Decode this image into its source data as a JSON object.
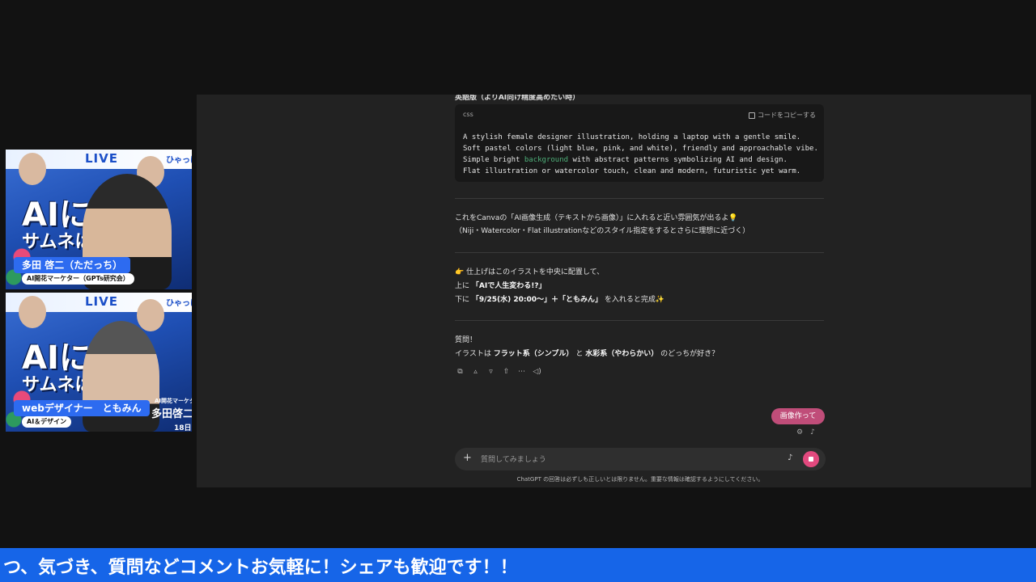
{
  "camera_top": {
    "live_label": "LIVE",
    "headline": "AIに指示",
    "subline": "サムネはとる？",
    "side_text": "ひゃっほ",
    "name": "多田 啓二（ただっち）",
    "role": "AI開花マーケター（GPTs研究会）"
  },
  "camera_bottom": {
    "live_label": "LIVE",
    "headline": "AIに示",
    "subline": "サムネは？",
    "side_text": "ひゃっほ",
    "name": "webデザイナー　ともみん",
    "role": "AI＆デザイン",
    "secondary_role": "AI開花マーケター",
    "secondary_name": "多田啓二",
    "corner_text": "18日"
  },
  "chat": {
    "section_heading": "英語版（よりAI向け精度高めたい時）",
    "code": {
      "language": "css",
      "copy_label": "コードをコピーする",
      "line1": "A stylish female designer illustration, holding a laptop with a gentle smile.",
      "line2": "Soft pastel colors (light blue, pink, and white), friendly and approachable vibe.",
      "line3_pre": "Simple bright ",
      "line3_kw": "background",
      "line3_post": " with abstract patterns symbolizing AI and design.",
      "line4": "Flat illustration or watercolor touch, clean and modern, futuristic yet warm."
    },
    "para1_line1": "これをCanvaの「AI画像生成（テキストから画像）」に入れると近い雰囲気が出るよ💡",
    "para1_line2": "（Niji・Watercolor・Flat illustrationなどのスタイル指定をするとさらに理想に近づく）",
    "para2_line1": "👉 仕上げはこのイラストを中央に配置して、",
    "para2_line2_pre": "上に",
    "para2_line2_bold": "「AIで人生変わる!?」",
    "para2_line3_pre": "下に",
    "para2_line3_bold": "「9/25(水) 20:00〜」＋「ともみん」",
    "para2_line3_post": "を入れると完成✨",
    "q_title": "質問！",
    "q_pre": "イラストは",
    "q_bold1": "フラット系（シンプル）",
    "q_mid": "と",
    "q_bold2": "水彩系（やわらかい）",
    "q_post": "のどっちが好き？",
    "action_icons": [
      "copy-icon",
      "thumbs-up-icon",
      "thumbs-down-icon",
      "share-icon",
      "more-icon",
      "speaker-icon"
    ],
    "image_chip": "画像作って",
    "composer_placeholder": "質問してみましょう",
    "disclaimer": "ChatGPT の回答は必ずしも正しいとは限りません。重要な情報は確認するようにしてください。"
  },
  "ticker": {
    "text": "つ、気づき、質問などコメントお気軽に！シェアも歓迎です！！"
  },
  "colors": {
    "ticker_bg": "#1665e8",
    "chip_pink": "#c04d79",
    "stop_pink": "#e2497e",
    "keyword_green": "#4fb07a"
  }
}
